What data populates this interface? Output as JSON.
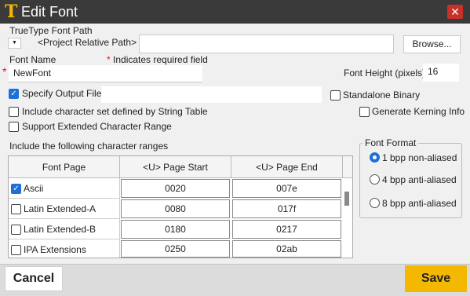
{
  "window": {
    "title": "Edit Font",
    "logo_glyph": "T",
    "close_glyph": "✕",
    "colors": {
      "titlebar": "#3a3a3a",
      "logo": "#f2b705",
      "close": "#c8312a",
      "accent": "#1f6fd6",
      "save": "#f5b800"
    }
  },
  "font_path": {
    "label": "TrueType Font Path",
    "dropdown_glyph": "▼",
    "selected_option": "<Project Relative Path>",
    "value": "",
    "browse_label": "Browse..."
  },
  "font_name": {
    "label": "Font Name",
    "required_note": "Indicates required field",
    "required_star": "*",
    "value": "NewFont"
  },
  "font_height": {
    "label": "Font Height (pixels)",
    "value": "16"
  },
  "options": {
    "specify_output": {
      "label": "Specify Output File",
      "checked": true,
      "value": ""
    },
    "standalone_binary": {
      "label": "Standalone Binary",
      "checked": false
    },
    "include_string_table": {
      "label": "Include character set defined by String Table",
      "checked": false
    },
    "generate_kerning": {
      "label": "Generate Kerning Info",
      "checked": false
    },
    "extended_range": {
      "label": "Support Extended Character Range",
      "checked": false
    }
  },
  "ranges": {
    "label": "Include the following character ranges",
    "columns": [
      "Font Page",
      "<U> Page Start",
      "<U> Page End"
    ],
    "rows": [
      {
        "page": "Ascii",
        "checked": true,
        "start": "0020",
        "end": "007e"
      },
      {
        "page": "Latin Extended-A",
        "checked": false,
        "start": "0080",
        "end": "017f"
      },
      {
        "page": "Latin Extended-B",
        "checked": false,
        "start": "0180",
        "end": "0217"
      },
      {
        "page": "IPA Extensions",
        "checked": false,
        "start": "0250",
        "end": "02ab"
      }
    ]
  },
  "font_format": {
    "title": "Font Format",
    "options": [
      {
        "label": "1 bpp non-aliased",
        "selected": true
      },
      {
        "label": "4 bpp anti-aliased",
        "selected": false
      },
      {
        "label": "8 bpp anti-aliased",
        "selected": false
      }
    ]
  },
  "buttons": {
    "cancel": "Cancel",
    "save": "Save"
  }
}
